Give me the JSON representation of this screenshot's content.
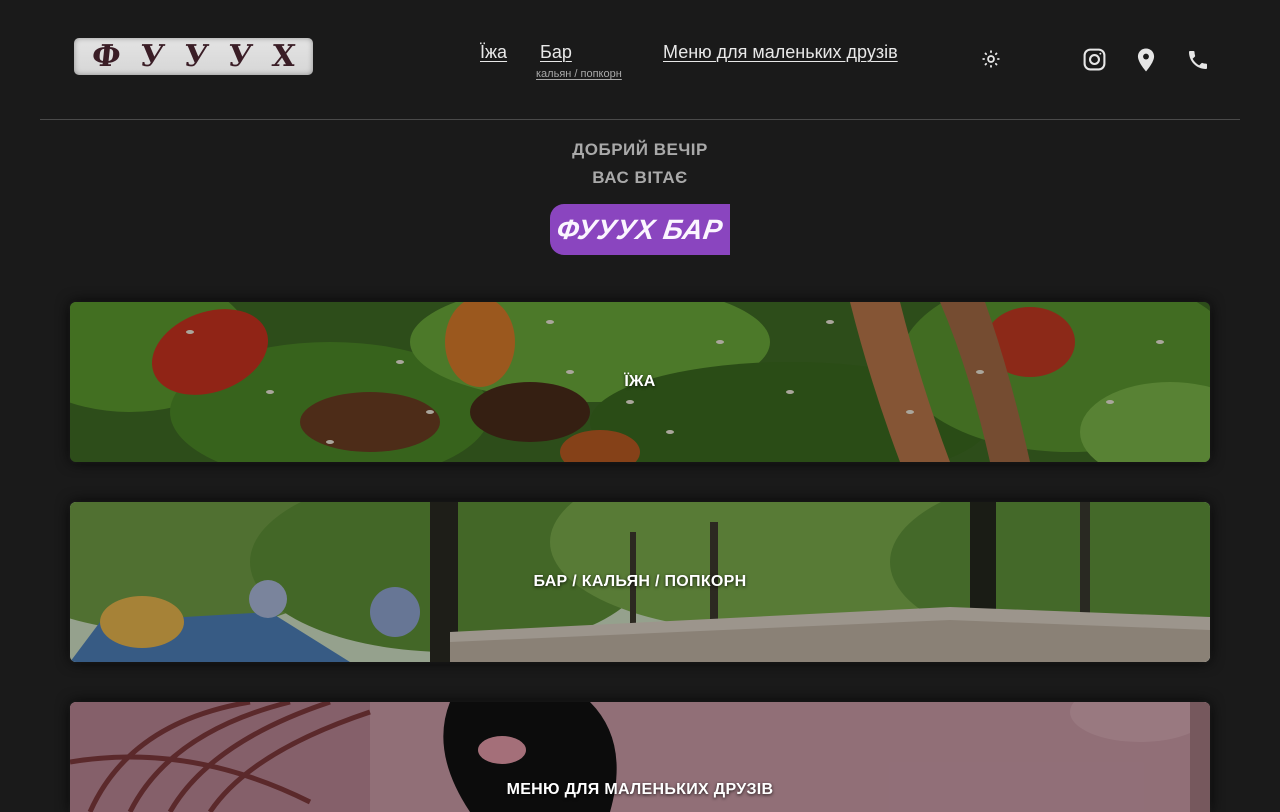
{
  "header": {
    "logo_letters": [
      "Ф",
      "У",
      "У",
      "У",
      "Х"
    ],
    "nav": {
      "food": "Їжа",
      "bar": "Бар",
      "bar_sub": "кальян / попкорн",
      "kids": "Меню для маленьких друзів"
    },
    "icons": [
      "theme-toggle-icon",
      "instagram-icon",
      "location-pin-icon",
      "phone-icon"
    ]
  },
  "greeting": {
    "line1": "ДОБРИЙ ВЕЧІР",
    "line2": "ВАС ВІТАЄ",
    "brand": "ФУУУХ БАР"
  },
  "cards": [
    {
      "label": "ЇЖА"
    },
    {
      "label": "БАР / КАЛЬЯН / ПОПКОРН"
    },
    {
      "label": "МЕНЮ ДЛЯ МАЛЕНЬКИХ ДРУЗІВ"
    }
  ],
  "colors": {
    "background": "#1a1a1a",
    "accent": "#8a45bf",
    "divider": "#4a4a4a"
  }
}
